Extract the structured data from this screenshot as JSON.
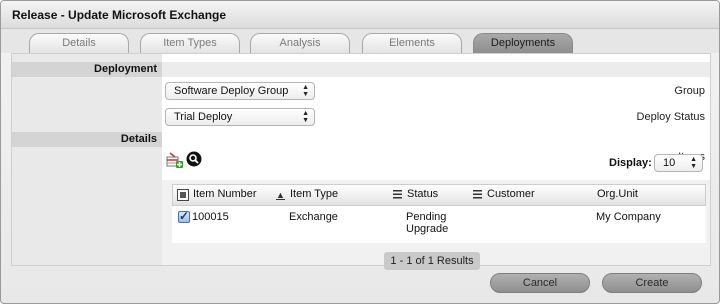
{
  "window": {
    "title": "Release - Update Microsoft Exchange"
  },
  "tabs": [
    {
      "label": "Details",
      "active": false
    },
    {
      "label": "Item Types",
      "active": false
    },
    {
      "label": "Analysis",
      "active": false
    },
    {
      "label": "Elements",
      "active": false
    },
    {
      "label": "Deployments",
      "active": true
    }
  ],
  "deployment": {
    "section_title": "Deployment",
    "group_label": "Group",
    "group_value": "Software Deploy Group",
    "status_label": "Deploy Status",
    "status_value": "Trial Deploy"
  },
  "details": {
    "section_title": "Details",
    "items_label": "Items",
    "add_icon": "add-item-icon",
    "search_icon": "search-icon",
    "display_label": "Display:",
    "display_value": "10"
  },
  "table": {
    "columns": [
      "Item Number",
      "Item Type",
      "Status",
      "Customer",
      "Org.Unit"
    ],
    "rows": [
      {
        "checked": true,
        "item_number": "100015",
        "item_type": "Exchange",
        "status_line1": "Pending",
        "status_line2": "Upgrade",
        "customer": "",
        "org_unit": "My Company"
      }
    ],
    "results": "1 - 1 of 1 Results"
  },
  "buttons": {
    "cancel": "Cancel",
    "create": "Create"
  },
  "colors": {
    "active_tab": "#999999",
    "section_header": "#d4d4d4",
    "button": "#a0a0a0"
  }
}
